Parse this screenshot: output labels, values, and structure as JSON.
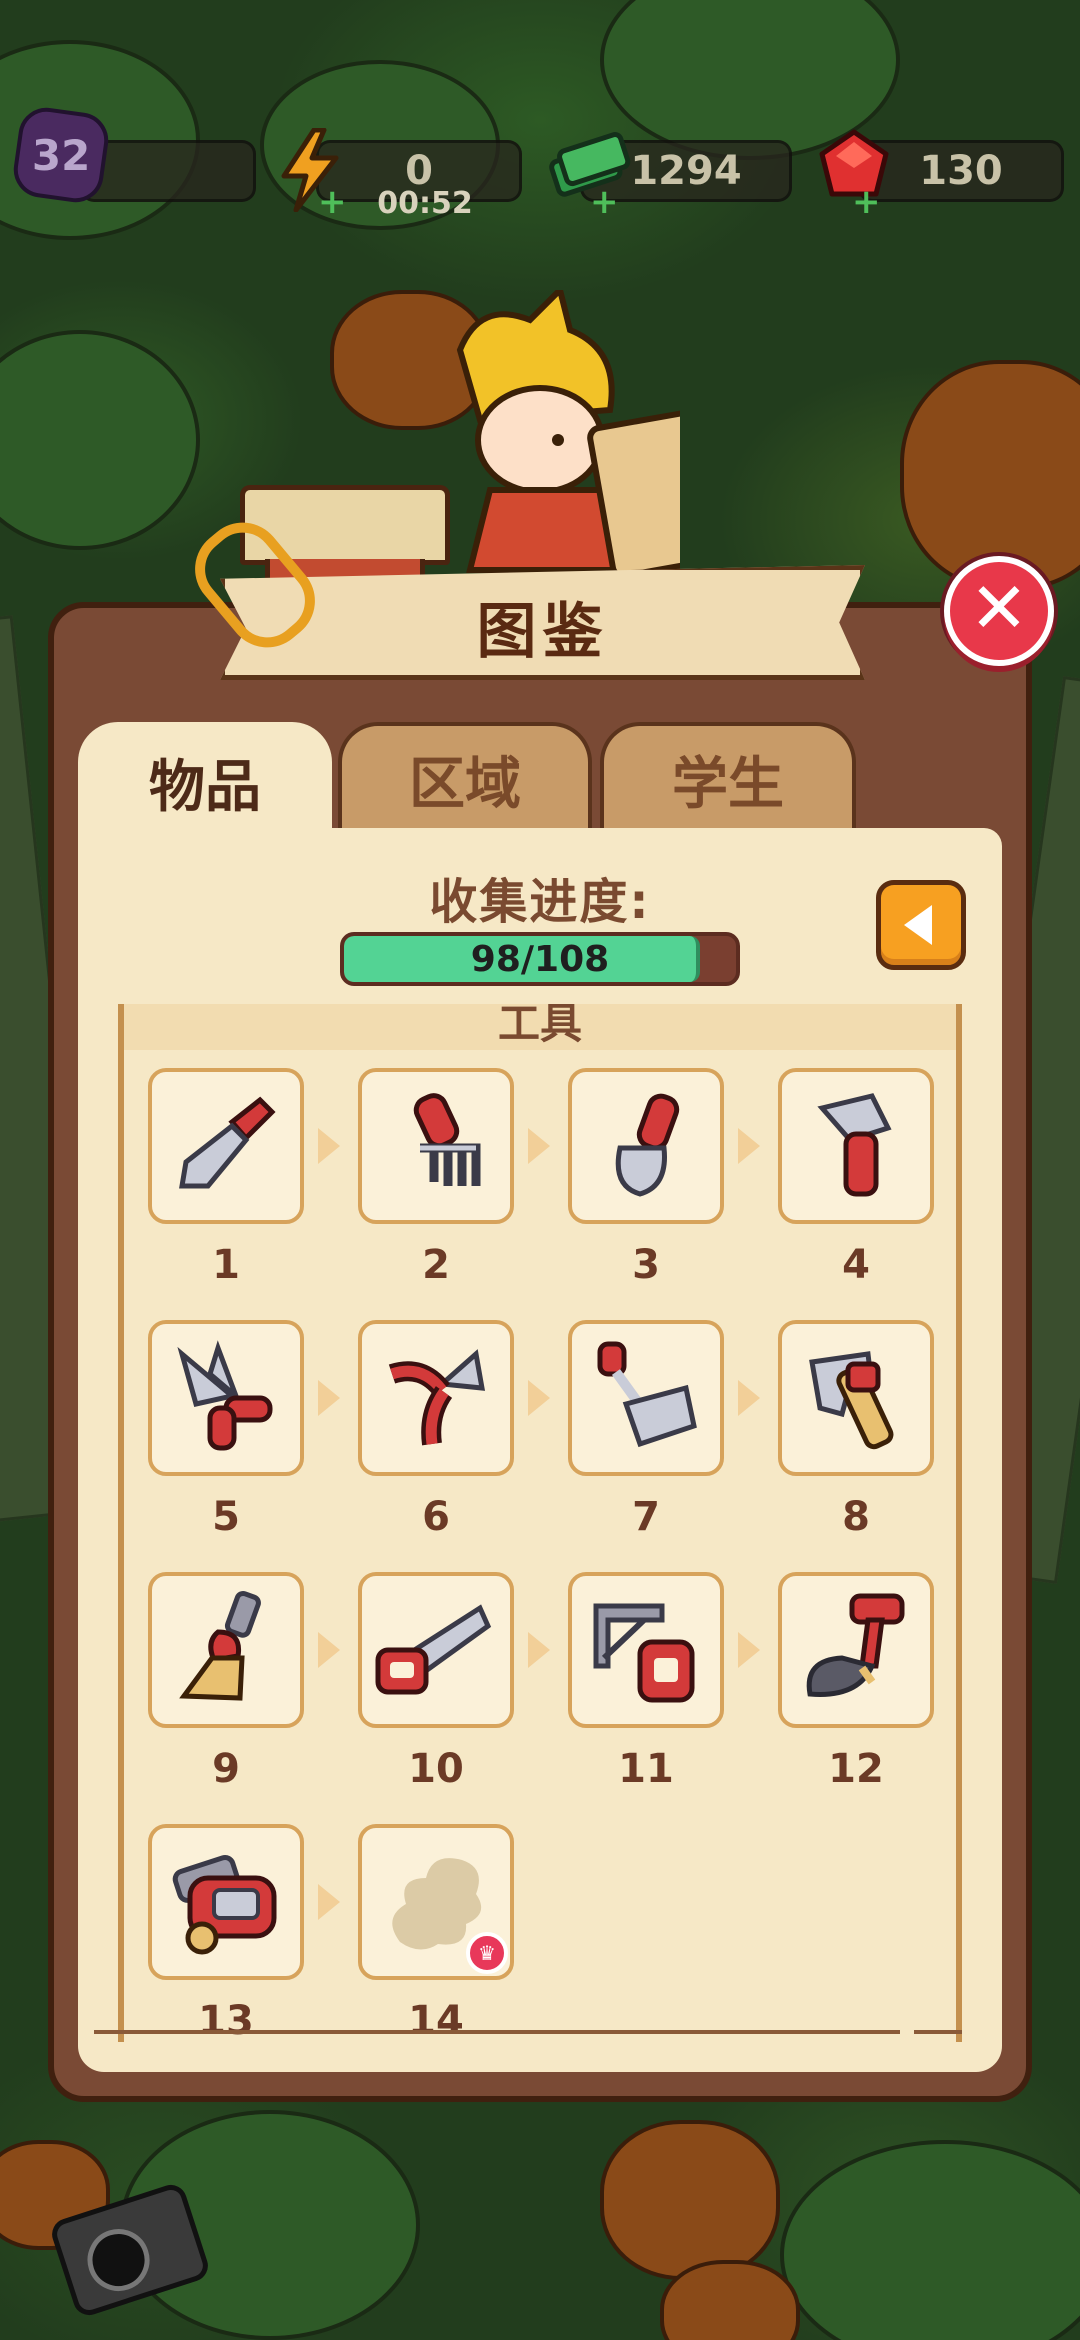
{
  "hud": {
    "level": "32",
    "energy": "0",
    "energy_timer": "00:52",
    "cash": "1294",
    "gems": "130"
  },
  "header": {
    "title": "图鉴"
  },
  "tabs": [
    {
      "label": "物品",
      "active": true
    },
    {
      "label": "区域",
      "active": false
    },
    {
      "label": "学生",
      "active": false
    }
  ],
  "progress": {
    "label": "收集进度:",
    "text": "98/108",
    "value": 98,
    "max": 108
  },
  "section": {
    "title": "工具"
  },
  "items": [
    {
      "num": "1",
      "icon": "trowel-icon"
    },
    {
      "num": "2",
      "icon": "hand-rake-icon"
    },
    {
      "num": "3",
      "icon": "shovel-icon"
    },
    {
      "num": "4",
      "icon": "hatchet-icon"
    },
    {
      "num": "5",
      "icon": "shears-icon"
    },
    {
      "num": "6",
      "icon": "pruner-icon"
    },
    {
      "num": "7",
      "icon": "rake-icon"
    },
    {
      "num": "8",
      "icon": "hammer-icon"
    },
    {
      "num": "9",
      "icon": "broom-icon"
    },
    {
      "num": "10",
      "icon": "handsaw-icon"
    },
    {
      "num": "11",
      "icon": "hacksaw-icon"
    },
    {
      "num": "12",
      "icon": "spade-icon"
    },
    {
      "num": "13",
      "icon": "chainsaw-icon"
    },
    {
      "num": "14",
      "icon": "locked-silhouette-icon"
    }
  ]
}
